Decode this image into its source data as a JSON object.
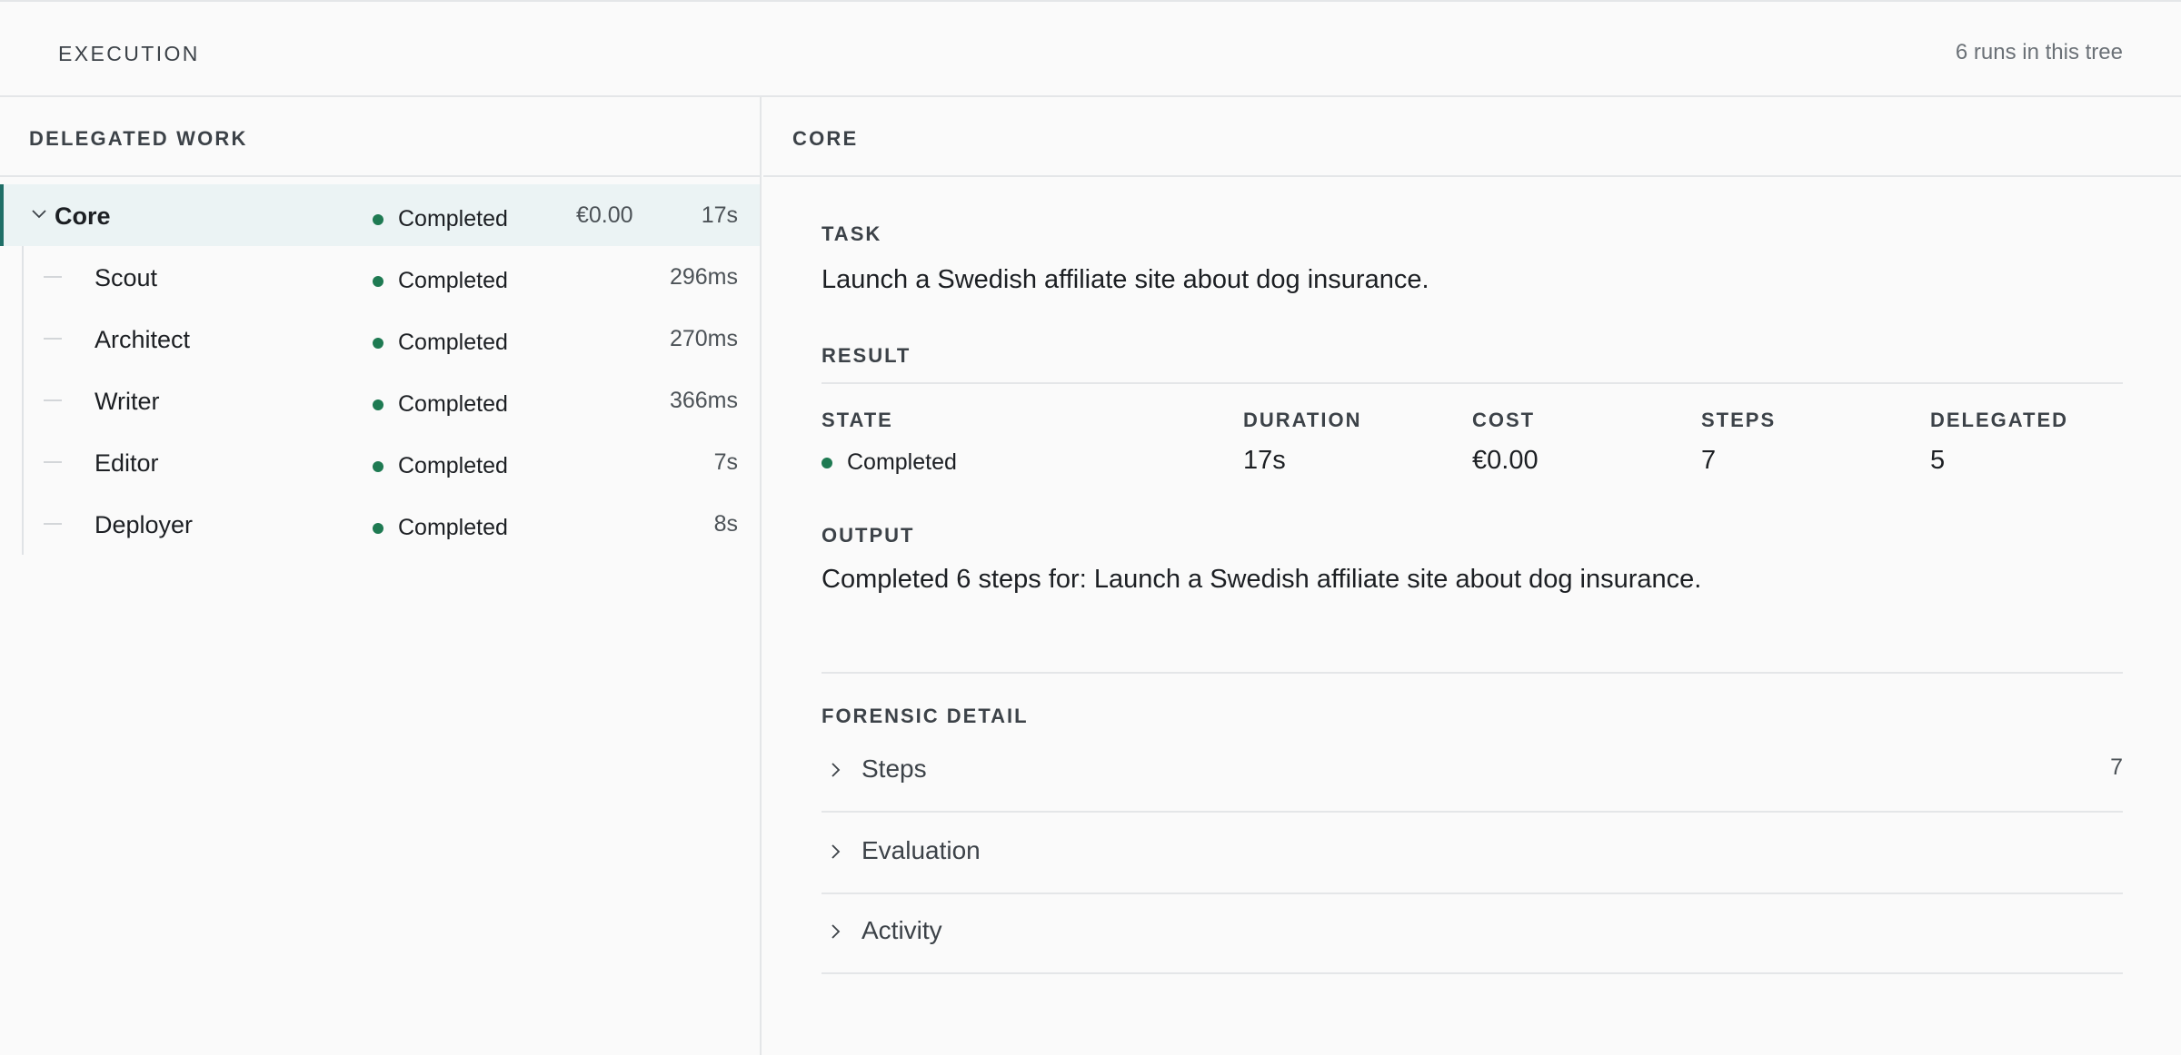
{
  "header": {
    "title": "EXECUTION",
    "runs_count": "6 runs in this tree"
  },
  "left_pane": {
    "title": "DELEGATED WORK",
    "rows": [
      {
        "name": "Core",
        "status": "Completed",
        "cost": "€0.00",
        "duration": "17s",
        "expanded": true,
        "selected": true
      },
      {
        "name": "Scout",
        "status": "Completed",
        "cost": "",
        "duration": "296ms"
      },
      {
        "name": "Architect",
        "status": "Completed",
        "cost": "",
        "duration": "270ms"
      },
      {
        "name": "Writer",
        "status": "Completed",
        "cost": "",
        "duration": "366ms"
      },
      {
        "name": "Editor",
        "status": "Completed",
        "cost": "",
        "duration": "7s"
      },
      {
        "name": "Deployer",
        "status": "Completed",
        "cost": "",
        "duration": "8s"
      }
    ]
  },
  "right_pane": {
    "title": "CORE",
    "task_label": "TASK",
    "task_text": "Launch a Swedish affiliate site about dog insurance.",
    "result_label": "RESULT",
    "stats": {
      "state_label": "STATE",
      "state_value": "Completed",
      "duration_label": "DURATION",
      "duration_value": "17s",
      "cost_label": "COST",
      "cost_value": "€0.00",
      "steps_label": "STEPS",
      "steps_value": "7",
      "delegated_label": "DELEGATED",
      "delegated_value": "5"
    },
    "output_label": "OUTPUT",
    "output_text": "Completed 6 steps for: Launch a Swedish affiliate site about dog insurance.",
    "forensic_label": "FORENSIC DETAIL",
    "accordion": [
      {
        "label": "Steps",
        "count": "7"
      },
      {
        "label": "Evaluation",
        "count": ""
      },
      {
        "label": "Activity",
        "count": ""
      }
    ]
  },
  "colors": {
    "accent": "#1f6f67",
    "status_green": "#1e7a52",
    "selected_bg": "#ebf3f4"
  }
}
